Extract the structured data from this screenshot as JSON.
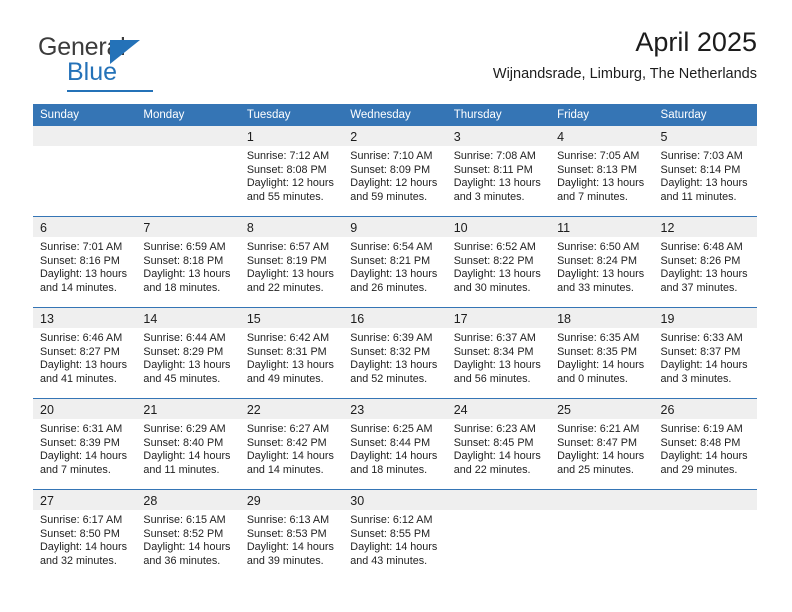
{
  "brand": {
    "name_part1": "General",
    "name_part2": "Blue",
    "accent_color": "#2472b8"
  },
  "header": {
    "title": "April 2025",
    "subtitle": "Wijnandsrade, Limburg, The Netherlands"
  },
  "theme": {
    "header_row_color": "#3575b5",
    "daynum_band_color": "#efefef",
    "separator_color": "#3575b5"
  },
  "columns": [
    "Sunday",
    "Monday",
    "Tuesday",
    "Wednesday",
    "Thursday",
    "Friday",
    "Saturday"
  ],
  "weeks": [
    [
      {
        "day": "",
        "empty": true,
        "sunrise": "",
        "sunset": "",
        "daylight_line1": "",
        "daylight_line2": ""
      },
      {
        "day": "",
        "empty": true,
        "sunrise": "",
        "sunset": "",
        "daylight_line1": "",
        "daylight_line2": ""
      },
      {
        "day": "1",
        "sunrise": "Sunrise: 7:12 AM",
        "sunset": "Sunset: 8:08 PM",
        "daylight_line1": "Daylight: 12 hours",
        "daylight_line2": "and 55 minutes."
      },
      {
        "day": "2",
        "sunrise": "Sunrise: 7:10 AM",
        "sunset": "Sunset: 8:09 PM",
        "daylight_line1": "Daylight: 12 hours",
        "daylight_line2": "and 59 minutes."
      },
      {
        "day": "3",
        "sunrise": "Sunrise: 7:08 AM",
        "sunset": "Sunset: 8:11 PM",
        "daylight_line1": "Daylight: 13 hours",
        "daylight_line2": "and 3 minutes."
      },
      {
        "day": "4",
        "sunrise": "Sunrise: 7:05 AM",
        "sunset": "Sunset: 8:13 PM",
        "daylight_line1": "Daylight: 13 hours",
        "daylight_line2": "and 7 minutes."
      },
      {
        "day": "5",
        "sunrise": "Sunrise: 7:03 AM",
        "sunset": "Sunset: 8:14 PM",
        "daylight_line1": "Daylight: 13 hours",
        "daylight_line2": "and 11 minutes."
      }
    ],
    [
      {
        "day": "6",
        "sunrise": "Sunrise: 7:01 AM",
        "sunset": "Sunset: 8:16 PM",
        "daylight_line1": "Daylight: 13 hours",
        "daylight_line2": "and 14 minutes."
      },
      {
        "day": "7",
        "sunrise": "Sunrise: 6:59 AM",
        "sunset": "Sunset: 8:18 PM",
        "daylight_line1": "Daylight: 13 hours",
        "daylight_line2": "and 18 minutes."
      },
      {
        "day": "8",
        "sunrise": "Sunrise: 6:57 AM",
        "sunset": "Sunset: 8:19 PM",
        "daylight_line1": "Daylight: 13 hours",
        "daylight_line2": "and 22 minutes."
      },
      {
        "day": "9",
        "sunrise": "Sunrise: 6:54 AM",
        "sunset": "Sunset: 8:21 PM",
        "daylight_line1": "Daylight: 13 hours",
        "daylight_line2": "and 26 minutes."
      },
      {
        "day": "10",
        "sunrise": "Sunrise: 6:52 AM",
        "sunset": "Sunset: 8:22 PM",
        "daylight_line1": "Daylight: 13 hours",
        "daylight_line2": "and 30 minutes."
      },
      {
        "day": "11",
        "sunrise": "Sunrise: 6:50 AM",
        "sunset": "Sunset: 8:24 PM",
        "daylight_line1": "Daylight: 13 hours",
        "daylight_line2": "and 33 minutes."
      },
      {
        "day": "12",
        "sunrise": "Sunrise: 6:48 AM",
        "sunset": "Sunset: 8:26 PM",
        "daylight_line1": "Daylight: 13 hours",
        "daylight_line2": "and 37 minutes."
      }
    ],
    [
      {
        "day": "13",
        "sunrise": "Sunrise: 6:46 AM",
        "sunset": "Sunset: 8:27 PM",
        "daylight_line1": "Daylight: 13 hours",
        "daylight_line2": "and 41 minutes."
      },
      {
        "day": "14",
        "sunrise": "Sunrise: 6:44 AM",
        "sunset": "Sunset: 8:29 PM",
        "daylight_line1": "Daylight: 13 hours",
        "daylight_line2": "and 45 minutes."
      },
      {
        "day": "15",
        "sunrise": "Sunrise: 6:42 AM",
        "sunset": "Sunset: 8:31 PM",
        "daylight_line1": "Daylight: 13 hours",
        "daylight_line2": "and 49 minutes."
      },
      {
        "day": "16",
        "sunrise": "Sunrise: 6:39 AM",
        "sunset": "Sunset: 8:32 PM",
        "daylight_line1": "Daylight: 13 hours",
        "daylight_line2": "and 52 minutes."
      },
      {
        "day": "17",
        "sunrise": "Sunrise: 6:37 AM",
        "sunset": "Sunset: 8:34 PM",
        "daylight_line1": "Daylight: 13 hours",
        "daylight_line2": "and 56 minutes."
      },
      {
        "day": "18",
        "sunrise": "Sunrise: 6:35 AM",
        "sunset": "Sunset: 8:35 PM",
        "daylight_line1": "Daylight: 14 hours",
        "daylight_line2": "and 0 minutes."
      },
      {
        "day": "19",
        "sunrise": "Sunrise: 6:33 AM",
        "sunset": "Sunset: 8:37 PM",
        "daylight_line1": "Daylight: 14 hours",
        "daylight_line2": "and 3 minutes."
      }
    ],
    [
      {
        "day": "20",
        "sunrise": "Sunrise: 6:31 AM",
        "sunset": "Sunset: 8:39 PM",
        "daylight_line1": "Daylight: 14 hours",
        "daylight_line2": "and 7 minutes."
      },
      {
        "day": "21",
        "sunrise": "Sunrise: 6:29 AM",
        "sunset": "Sunset: 8:40 PM",
        "daylight_line1": "Daylight: 14 hours",
        "daylight_line2": "and 11 minutes."
      },
      {
        "day": "22",
        "sunrise": "Sunrise: 6:27 AM",
        "sunset": "Sunset: 8:42 PM",
        "daylight_line1": "Daylight: 14 hours",
        "daylight_line2": "and 14 minutes."
      },
      {
        "day": "23",
        "sunrise": "Sunrise: 6:25 AM",
        "sunset": "Sunset: 8:44 PM",
        "daylight_line1": "Daylight: 14 hours",
        "daylight_line2": "and 18 minutes."
      },
      {
        "day": "24",
        "sunrise": "Sunrise: 6:23 AM",
        "sunset": "Sunset: 8:45 PM",
        "daylight_line1": "Daylight: 14 hours",
        "daylight_line2": "and 22 minutes."
      },
      {
        "day": "25",
        "sunrise": "Sunrise: 6:21 AM",
        "sunset": "Sunset: 8:47 PM",
        "daylight_line1": "Daylight: 14 hours",
        "daylight_line2": "and 25 minutes."
      },
      {
        "day": "26",
        "sunrise": "Sunrise: 6:19 AM",
        "sunset": "Sunset: 8:48 PM",
        "daylight_line1": "Daylight: 14 hours",
        "daylight_line2": "and 29 minutes."
      }
    ],
    [
      {
        "day": "27",
        "sunrise": "Sunrise: 6:17 AM",
        "sunset": "Sunset: 8:50 PM",
        "daylight_line1": "Daylight: 14 hours",
        "daylight_line2": "and 32 minutes."
      },
      {
        "day": "28",
        "sunrise": "Sunrise: 6:15 AM",
        "sunset": "Sunset: 8:52 PM",
        "daylight_line1": "Daylight: 14 hours",
        "daylight_line2": "and 36 minutes."
      },
      {
        "day": "29",
        "sunrise": "Sunrise: 6:13 AM",
        "sunset": "Sunset: 8:53 PM",
        "daylight_line1": "Daylight: 14 hours",
        "daylight_line2": "and 39 minutes."
      },
      {
        "day": "30",
        "sunrise": "Sunrise: 6:12 AM",
        "sunset": "Sunset: 8:55 PM",
        "daylight_line1": "Daylight: 14 hours",
        "daylight_line2": "and 43 minutes."
      },
      {
        "day": "",
        "empty": true,
        "sunrise": "",
        "sunset": "",
        "daylight_line1": "",
        "daylight_line2": ""
      },
      {
        "day": "",
        "empty": true,
        "sunrise": "",
        "sunset": "",
        "daylight_line1": "",
        "daylight_line2": ""
      },
      {
        "day": "",
        "empty": true,
        "sunrise": "",
        "sunset": "",
        "daylight_line1": "",
        "daylight_line2": ""
      }
    ]
  ]
}
